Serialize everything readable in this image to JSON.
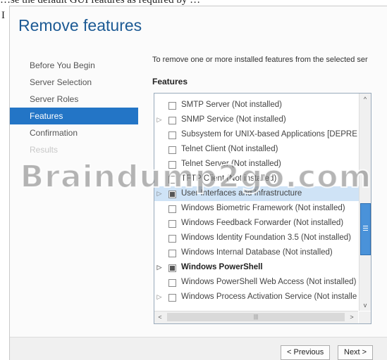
{
  "top_fragment": "…se the default GUI features as required by …",
  "side_letter": "I",
  "window": {
    "title": "Remove features",
    "nav": [
      {
        "label": "Before You Begin",
        "state": "normal"
      },
      {
        "label": "Server Selection",
        "state": "normal"
      },
      {
        "label": "Server Roles",
        "state": "normal"
      },
      {
        "label": "Features",
        "state": "active"
      },
      {
        "label": "Confirmation",
        "state": "normal"
      },
      {
        "label": "Results",
        "state": "disabled"
      }
    ],
    "description": "To remove one or more installed features from the selected ser",
    "features_label": "Features",
    "features": [
      {
        "label": "SMTP Server (Not installed)",
        "expander": false,
        "check": "unchecked",
        "bold": false,
        "selected": false
      },
      {
        "label": "SNMP Service (Not installed)",
        "expander": true,
        "check": "unchecked",
        "bold": false,
        "selected": false
      },
      {
        "label": "Subsystem for UNIX-based Applications [DEPRE",
        "expander": false,
        "check": "unchecked",
        "bold": false,
        "selected": false
      },
      {
        "label": "Telnet Client (Not installed)",
        "expander": false,
        "check": "unchecked",
        "bold": false,
        "selected": false
      },
      {
        "label": "Telnet Server (Not installed)",
        "expander": false,
        "check": "unchecked",
        "bold": false,
        "selected": false
      },
      {
        "label": "TFTP Client (Not installed)",
        "expander": false,
        "check": "unchecked",
        "bold": false,
        "selected": false
      },
      {
        "label": "User Interfaces and Infrastructure",
        "expander": true,
        "check": "partial",
        "bold": false,
        "selected": true
      },
      {
        "label": "Windows Biometric Framework (Not installed)",
        "expander": false,
        "check": "unchecked",
        "bold": false,
        "selected": false
      },
      {
        "label": "Windows Feedback Forwarder (Not installed)",
        "expander": false,
        "check": "unchecked",
        "bold": false,
        "selected": false
      },
      {
        "label": "Windows Identity Foundation 3.5 (Not installed)",
        "expander": false,
        "check": "unchecked",
        "bold": false,
        "selected": false
      },
      {
        "label": "Windows Internal Database (Not installed)",
        "expander": false,
        "check": "unchecked",
        "bold": false,
        "selected": false
      },
      {
        "label": "Windows PowerShell",
        "expander": true,
        "check": "partial",
        "bold": true,
        "selected": false
      },
      {
        "label": "Windows PowerShell Web Access (Not installed)",
        "expander": false,
        "check": "unchecked",
        "bold": false,
        "selected": false
      },
      {
        "label": "Windows Process Activation Service (Not installe",
        "expander": true,
        "check": "unchecked",
        "bold": false,
        "selected": false
      }
    ],
    "scroll_up": "^",
    "scroll_down": "v",
    "scroll_left": "<",
    "scroll_right": ">",
    "prev_button": "< Previous",
    "next_button": "Next >"
  },
  "watermark": "Braindump2go.com",
  "colors": {
    "accent": "#2375c6",
    "title": "#1c5a94",
    "thumb": "#4a92d9"
  }
}
